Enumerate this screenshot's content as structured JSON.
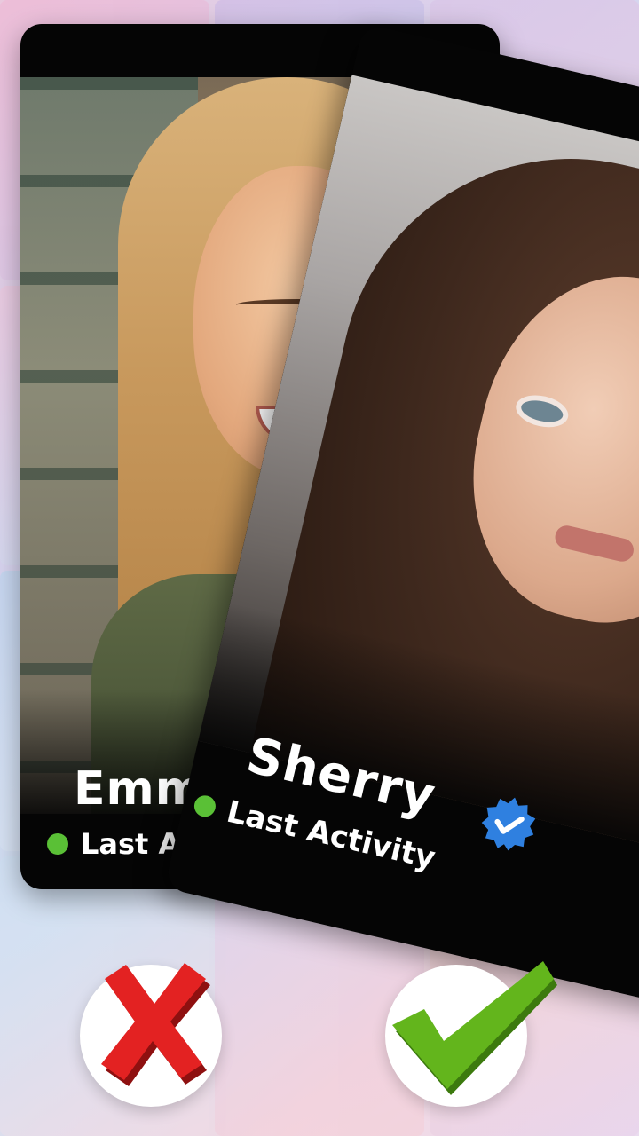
{
  "cards": {
    "emma": {
      "name": "Emma",
      "activity_label": "Last Activity"
    },
    "sherry": {
      "name": "Sherry",
      "activity_label": "Last Activity",
      "badge_icon": "verified-check-icon"
    }
  },
  "actions": {
    "reject_icon": "x-icon",
    "like_icon": "checkmark-icon"
  },
  "colors": {
    "online_dot": "#5ac036",
    "verified_badge": "#2f80e0",
    "reject": "#e32222",
    "like": "#63b51c"
  }
}
